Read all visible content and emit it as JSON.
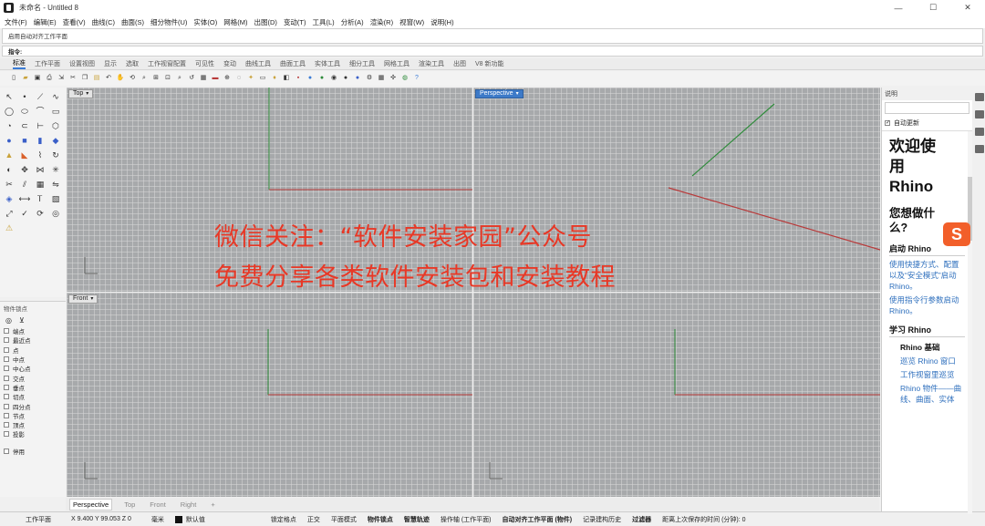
{
  "window": {
    "title": "未命名 - Untitled 8",
    "controls": [
      "—",
      "☐",
      "✕"
    ]
  },
  "menu": [
    "文件(F)",
    "编辑(E)",
    "查看(V)",
    "曲线(C)",
    "曲面(S)",
    "细分物件(U)",
    "实体(O)",
    "网格(M)",
    "出图(D)",
    "变动(T)",
    "工具(L)",
    "分析(A)",
    "渲染(R)",
    "视窗(W)",
    "说明(H)"
  ],
  "command": {
    "history": "启用自动对齐工作平面",
    "prompt_label": "指令:",
    "input_value": ""
  },
  "toolbar_tabs": [
    "标准",
    "工作平面",
    "设置视图",
    "显示",
    "选取",
    "工作视窗配置",
    "可见性",
    "变动",
    "曲线工具",
    "曲面工具",
    "实体工具",
    "细分工具",
    "网格工具",
    "渲染工具",
    "出图",
    "V8 新功能"
  ],
  "viewports": {
    "top": "Top",
    "perspective": "Perspective",
    "front": "Front",
    "right": "Right",
    "caret": "▾"
  },
  "viewport_tabs": [
    "Perspective",
    "Top",
    "Front",
    "Right"
  ],
  "viewport_tab_add": "+",
  "osnap": {
    "title": "物件锁点",
    "items": [
      "端点",
      "最近点",
      "点",
      "中点",
      "中心点",
      "交点",
      "垂点",
      "切点",
      "四分点",
      "节点",
      "顶点",
      "投影"
    ],
    "disable": "停用"
  },
  "statusbar": {
    "workplane": "工作平面",
    "coords": "X 9.400 Y 99.053 Z 0",
    "units": "毫米",
    "layer": "默认值",
    "items": [
      "锁定格点",
      "正交",
      "平面模式",
      "物件锁点",
      "智慧轨迹",
      "操作轴 (工作平面)",
      "自动对齐工作平面 (物件)",
      "记录建构历史",
      "过滤器",
      "距离上次保存的时间 (分钟): 0"
    ]
  },
  "help_panel": {
    "title": "说明",
    "auto_update": "自动更新",
    "welcome": [
      "欢迎使",
      "用",
      "Rhino"
    ],
    "want": [
      "您想做什",
      "么?"
    ],
    "start_heading": "启动 Rhino",
    "start_links": [
      "使用快捷方式、配置以及“安全模式”启动 Rhino。",
      "使用指令行参数启动 Rhino。"
    ],
    "learn_heading": "学习 Rhino",
    "basics": "Rhino 基础",
    "learn_links": [
      "巡览 Rhino 窗口",
      "工作视窗里巡览",
      "Rhino 物件——曲线、曲面、实体"
    ]
  },
  "overlay": {
    "line1": "微信关注：“软件安装家园”公众号",
    "line2": "免费分享各类软件安装包和安装教程",
    "logo": "S"
  },
  "colors": {
    "viewport_bg": "#a7a9ab",
    "x_axis": "#b83a3a",
    "y_axis": "#2e8b3a",
    "active_label": "#3d7ac8",
    "overlay_text": "#e83826"
  }
}
